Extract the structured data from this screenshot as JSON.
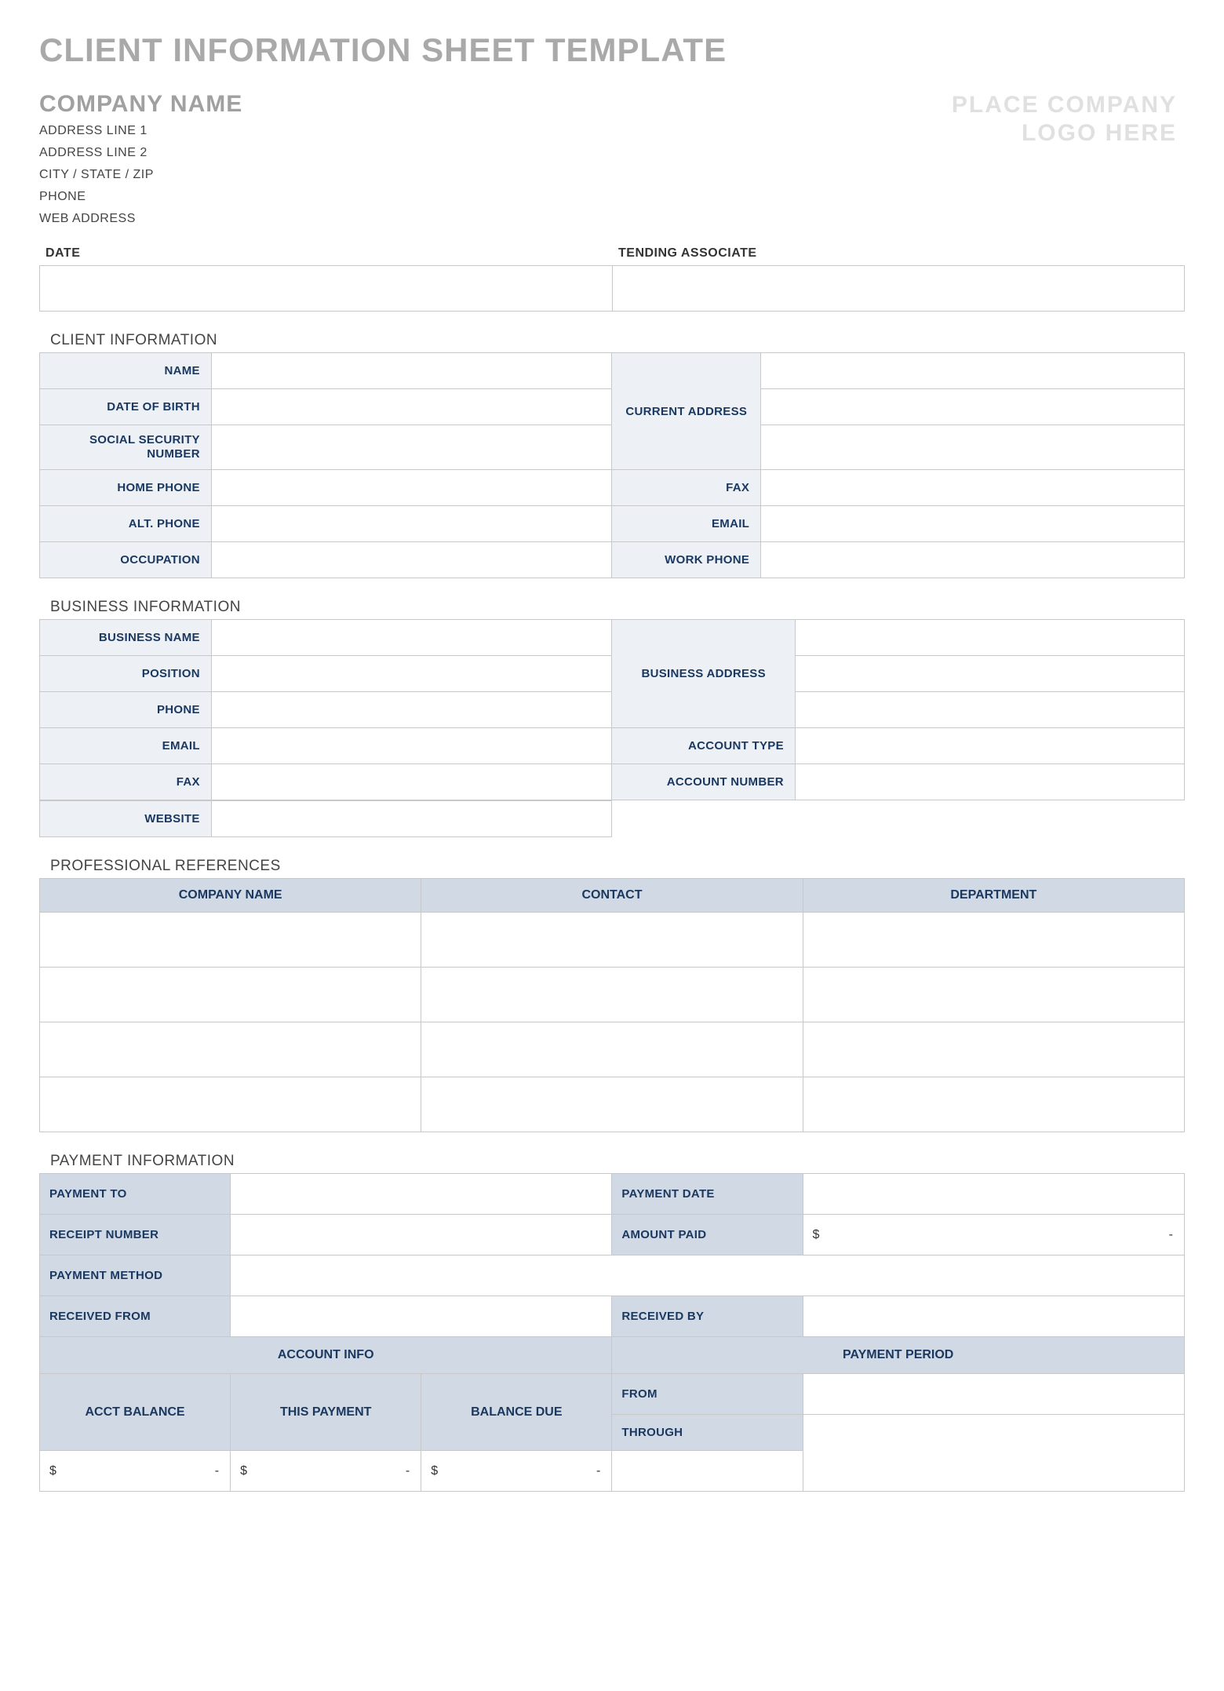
{
  "title": "CLIENT INFORMATION SHEET TEMPLATE",
  "company": {
    "name": "COMPANY NAME",
    "address1": "ADDRESS LINE 1",
    "address2": "ADDRESS LINE 2",
    "city": "CITY / STATE / ZIP",
    "phone": "PHONE",
    "web": "WEB ADDRESS",
    "logo_line1": "PLACE COMPANY",
    "logo_line2": "LOGO HERE"
  },
  "top": {
    "date_label": "DATE",
    "tending_label": "TENDING ASSOCIATE"
  },
  "client": {
    "section": "CLIENT INFORMATION",
    "name": "NAME",
    "dob": "DATE OF BIRTH",
    "ssn": "SOCIAL SECURITY NUMBER",
    "home_phone": "HOME PHONE",
    "alt_phone": "ALT. PHONE",
    "occupation": "OCCUPATION",
    "current_address": "CURRENT ADDRESS",
    "fax": "FAX",
    "email": "EMAIL",
    "work_phone": "WORK PHONE"
  },
  "business": {
    "section": "BUSINESS INFORMATION",
    "name": "BUSINESS NAME",
    "position": "POSITION",
    "phone": "PHONE",
    "email": "EMAIL",
    "fax": "FAX",
    "website": "WEBSITE",
    "address": "BUSINESS ADDRESS",
    "account_type": "ACCOUNT TYPE",
    "account_number": "ACCOUNT NUMBER"
  },
  "refs": {
    "section": "PROFESSIONAL REFERENCES",
    "col1": "COMPANY NAME",
    "col2": "CONTACT",
    "col3": "DEPARTMENT"
  },
  "payment": {
    "section": "PAYMENT INFORMATION",
    "payment_to": "PAYMENT TO",
    "payment_date": "PAYMENT DATE",
    "receipt_number": "RECEIPT NUMBER",
    "amount_paid": "AMOUNT PAID",
    "payment_method": "PAYMENT METHOD",
    "received_from": "RECEIVED FROM",
    "received_by": "RECEIVED BY",
    "account_info": "ACCOUNT INFO",
    "payment_period": "PAYMENT PERIOD",
    "acct_balance": "ACCT BALANCE",
    "this_payment": "THIS PAYMENT",
    "balance_due": "BALANCE DUE",
    "from": "FROM",
    "through": "THROUGH",
    "currency": "$",
    "dash": "-"
  }
}
